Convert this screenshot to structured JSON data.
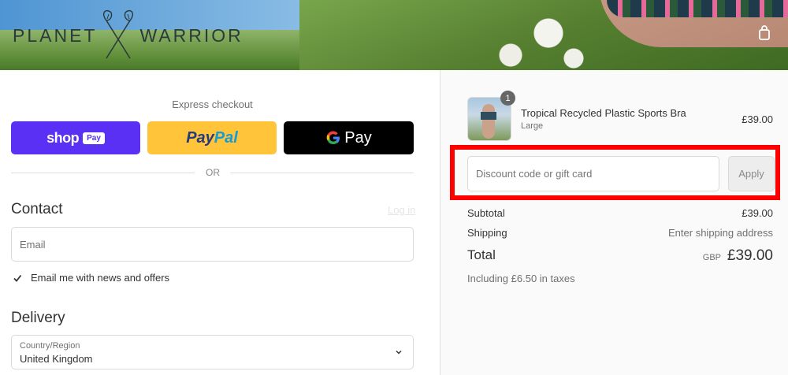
{
  "header": {
    "logo_left": "PLANET",
    "logo_right": "WARRIOR",
    "cart_icon": "shopping-bag-icon"
  },
  "express": {
    "title": "Express checkout",
    "shop_pay": {
      "word": "shop",
      "pill": "Pay",
      "color": "#5a31f4"
    },
    "paypal": {
      "part1": "Pay",
      "part2": "Pal",
      "color": "#ffc439"
    },
    "gpay": {
      "word": "Pay",
      "color": "#000000"
    },
    "or_text": "OR"
  },
  "contact": {
    "title": "Contact",
    "login_link": "Log in",
    "email_placeholder": "Email",
    "newsletter_label": "Email me with news and offers",
    "newsletter_checked": true
  },
  "delivery": {
    "title": "Delivery",
    "country_label": "Country/Region",
    "country_value": "United Kingdom"
  },
  "order": {
    "item": {
      "name": "Tropical Recycled Plastic Sports Bra",
      "variant": "Large",
      "price": "£39.00",
      "quantity": "1"
    },
    "discount_placeholder": "Discount code or gift card",
    "apply_label": "Apply",
    "subtotal_label": "Subtotal",
    "subtotal_value": "£39.00",
    "shipping_label": "Shipping",
    "shipping_value": "Enter shipping address",
    "total_label": "Total",
    "total_currency": "GBP",
    "total_value": "£39.00",
    "taxes_note": "Including £6.50 in taxes"
  },
  "colors": {
    "highlight": "#ff0000",
    "shop_purple": "#5a31f4",
    "paypal_yellow": "#ffc439"
  }
}
